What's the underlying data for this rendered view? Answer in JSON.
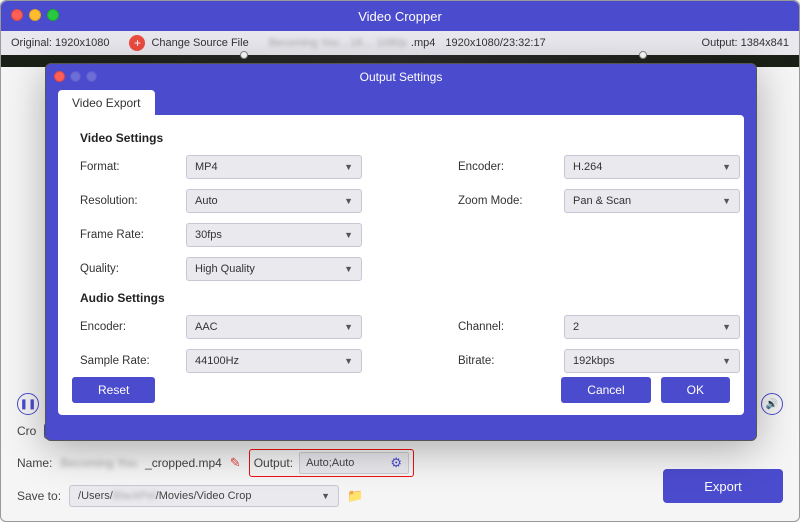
{
  "window": {
    "title": "Video Cropper",
    "original_label": "Original: 1920x1080",
    "change_source": "Change Source File",
    "source_file": "Becoming You…18… 1080p",
    "source_ext": ".mp4",
    "source_meta": "1920x1080/23:32:17",
    "output_label": "Output: 1384x841"
  },
  "dialog": {
    "title": "Output Settings",
    "tab": "Video Export",
    "video_section": "Video Settings",
    "audio_section": "Audio Settings",
    "labels": {
      "format": "Format:",
      "encoder": "Encoder:",
      "resolution": "Resolution:",
      "zoom": "Zoom Mode:",
      "framerate": "Frame Rate:",
      "quality": "Quality:",
      "aencoder": "Encoder:",
      "channel": "Channel:",
      "samplerate": "Sample Rate:",
      "bitrate": "Bitrate:"
    },
    "values": {
      "format": "MP4",
      "encoder": "H.264",
      "resolution": "Auto",
      "zoom": "Pan & Scan",
      "framerate": "30fps",
      "quality": "High Quality",
      "aencoder": "AAC",
      "channel": "2",
      "samplerate": "44100Hz",
      "bitrate": "192kbps"
    },
    "buttons": {
      "reset": "Reset",
      "cancel": "Cancel",
      "ok": "OK"
    }
  },
  "bottom": {
    "crop_label": "Cro",
    "name_label": "Name:",
    "name_value_blur": "Becoming You",
    "name_value_suffix": "_cropped.mp4",
    "output_label": "Output:",
    "output_value": "Auto;Auto",
    "save_label": "Save to:",
    "save_path_prefix": "/Users/",
    "save_path_blur": "BlackPel",
    "save_path_suffix": "/Movies/Video Crop",
    "export": "Export"
  }
}
